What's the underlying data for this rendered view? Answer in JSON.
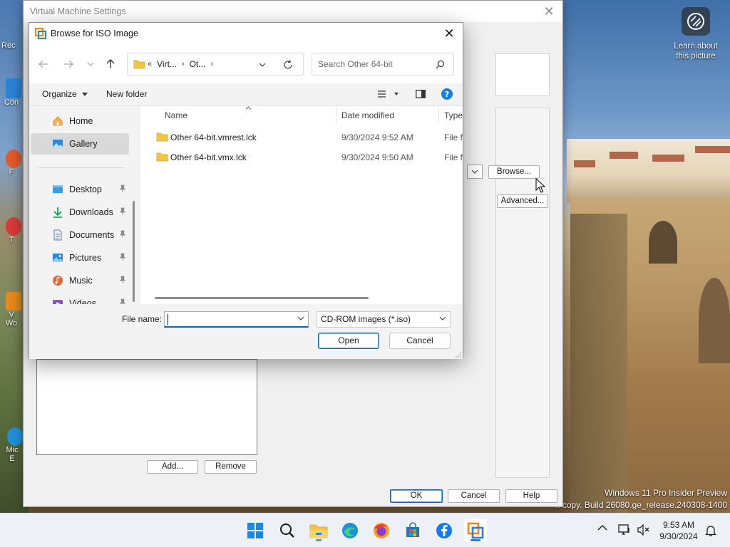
{
  "desktop": {
    "icon_labels": [
      "Rec",
      "Con",
      "F",
      "T",
      "V",
      "Wo",
      "Mic",
      "E"
    ],
    "learn_picture": "Learn about this picture",
    "watermark_line1": "Windows 11 Pro Insider Preview",
    "watermark_line2": "n copy. Build 26080.ge_release.240308-1400"
  },
  "vm_settings": {
    "title": "Virtual Machine Settings",
    "browse_label": "Browse...",
    "advanced_label": "Advanced...",
    "add_label": "Add...",
    "remove_label": "Remove",
    "ok_label": "OK",
    "cancel_label": "Cancel",
    "help_label": "Help"
  },
  "dialog": {
    "title": "Browse for ISO Image",
    "address": {
      "prefix": "«",
      "crumbs": [
        "Virt...",
        "Ot..."
      ]
    },
    "search_placeholder": "Search Other 64-bit",
    "toolbar": {
      "organize": "Organize",
      "new_folder": "New folder"
    },
    "nav": {
      "items": [
        {
          "label": "Home",
          "icon": "home-icon"
        },
        {
          "label": "Gallery",
          "icon": "gallery-icon",
          "selected": true
        },
        {
          "label": "Desktop",
          "icon": "desktop-icon",
          "pinned": true
        },
        {
          "label": "Downloads",
          "icon": "downloads-icon",
          "pinned": true
        },
        {
          "label": "Documents",
          "icon": "documents-icon",
          "pinned": true
        },
        {
          "label": "Pictures",
          "icon": "pictures-icon",
          "pinned": true
        },
        {
          "label": "Music",
          "icon": "music-icon",
          "pinned": true
        },
        {
          "label": "Videos",
          "icon": "videos-icon",
          "pinned": true
        }
      ]
    },
    "columns": {
      "name": "Name",
      "date": "Date modified",
      "type": "Type"
    },
    "files": [
      {
        "name": "Other 64-bit.vmrest.lck",
        "date": "9/30/2024 9:52 AM",
        "type": "File fo"
      },
      {
        "name": "Other 64-bit.vmx.lck",
        "date": "9/30/2024 9:50 AM",
        "type": "File fo"
      }
    ],
    "file_name_label": "File name:",
    "file_name_value": "",
    "filter": "CD-ROM images (*.iso)",
    "open_label": "Open",
    "cancel_label": "Cancel"
  },
  "taskbar": {
    "apps": [
      "start-icon",
      "search-icon",
      "file-explorer-icon",
      "edge-icon",
      "firefox-icon",
      "store-icon",
      "facebook-icon",
      "vmware-icon"
    ],
    "time": "9:53 AM",
    "date": "9/30/2024"
  },
  "colors": {
    "accent": "#0067c0",
    "folder": "#f4c542"
  }
}
